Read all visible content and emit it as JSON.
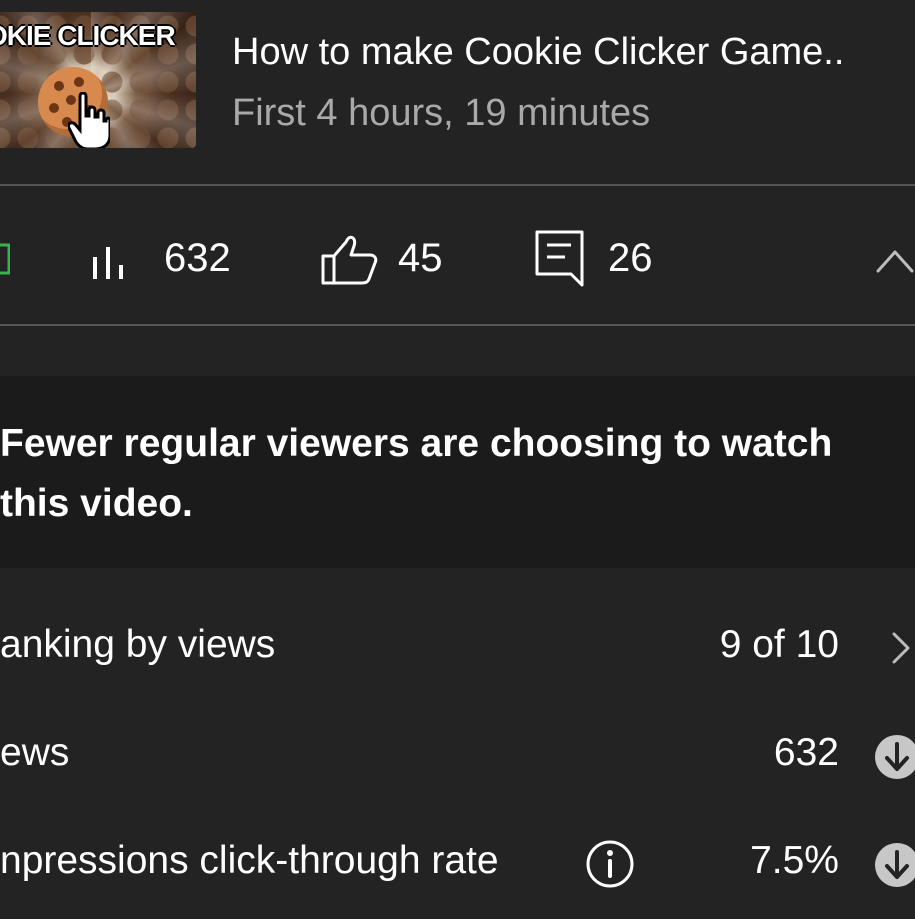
{
  "video": {
    "title": "How to make Cookie Clicker Game..",
    "subtitle": "First 4 hours, 19 minutes",
    "thumbnail_text": "OKIE CLICKER"
  },
  "stats": {
    "views": "632",
    "likes": "45",
    "comments": "26"
  },
  "alert": {
    "message": "Fewer regular viewers are choosing to watch this video."
  },
  "rows": [
    {
      "label": "anking by views",
      "value": "9 of 10"
    },
    {
      "label": "ews",
      "value": "632"
    },
    {
      "label": "npressions click-through rate",
      "value": "7.5%"
    }
  ],
  "colors": {
    "background": "#232323",
    "alert_background": "#1b1b1b",
    "divider": "#555555",
    "secondary_text": "#a9a9a9",
    "accent_green": "#36b34a"
  }
}
